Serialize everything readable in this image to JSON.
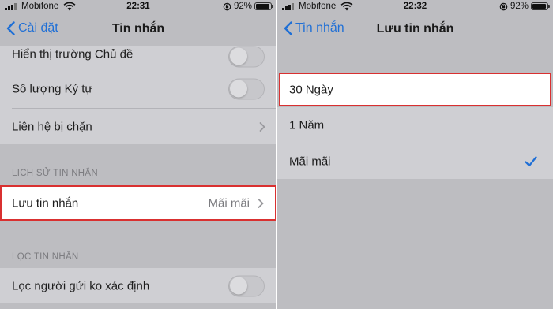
{
  "left": {
    "status": {
      "carrier": "Mobifone",
      "time": "22:31",
      "battery": "92%"
    },
    "nav": {
      "back_label": "Cài đặt",
      "title": "Tin nhắn"
    },
    "rows": [
      {
        "label": "Hiển thị trường Chủ đề",
        "toggle": false
      },
      {
        "label": "Số lượng Ký tự",
        "toggle": false
      },
      {
        "label": "Liên hệ bị chặn"
      }
    ],
    "history_header": "LỊCH SỬ TIN NHẮN",
    "keep_messages": {
      "label": "Lưu tin nhắn",
      "value": "Mãi mãi"
    },
    "filter_header": "LỌC TIN NHẮN",
    "filter_row": {
      "label": "Lọc người gửi ko xác định",
      "toggle": false
    }
  },
  "right": {
    "status": {
      "carrier": "Mobifone",
      "time": "22:32",
      "battery": "92%"
    },
    "nav": {
      "back_label": "Tin nhắn",
      "title": "Lưu tin nhắn"
    },
    "options": [
      {
        "label": "30 Ngày",
        "selected": false
      },
      {
        "label": "1 Năm",
        "selected": false
      },
      {
        "label": "Mãi mãi",
        "selected": true
      }
    ]
  },
  "colors": {
    "accent": "#1f6fd6",
    "highlight_border": "#d93030"
  },
  "icons": [
    "back-chevron-icon",
    "chevron-right-icon",
    "checkmark-icon",
    "wifi-icon",
    "rotation-lock-icon",
    "battery-icon",
    "signal-icon"
  ]
}
